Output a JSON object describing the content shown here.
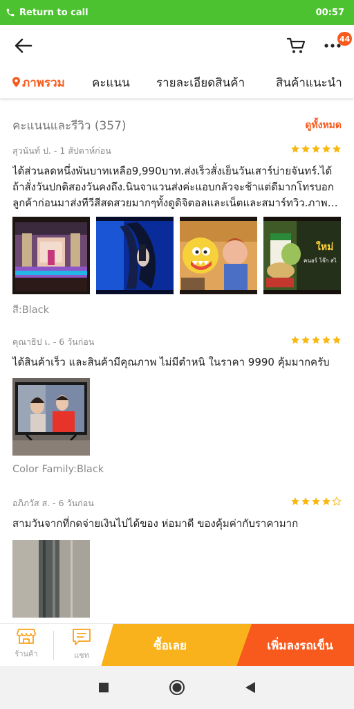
{
  "status_bar": {
    "call_text": "Return to call",
    "time": "00:57",
    "bg_color": "#4cc231"
  },
  "header": {
    "cart_badge": "44",
    "accent": "#f85a1d"
  },
  "tabs": [
    {
      "label": "ภาพรวม",
      "active": true
    },
    {
      "label": "คะแนน",
      "active": false
    },
    {
      "label": "รายละเอียดสินค้า",
      "active": false
    },
    {
      "label": "สินค้าแนะนำ",
      "active": false
    }
  ],
  "ratings_section": {
    "title": "คะแนนและรีวิว (357)",
    "see_all": "ดูทั้งหมด"
  },
  "reviews": [
    {
      "author_time": "สุวนันท์ ป. - 1 สัปดาห์ก่อน",
      "stars": 5,
      "text": "ได้ส่วนลดหนึ่งพันบาทเหลือ9,990บาท.ส่งเร็วสั่งเย็นวันเสาร์บ่ายจันทร์.ได้ถ้าสั่งวันปกติสองวันคงถึง.นินจาแวนส่งค่ะแอบกลัวจะช้าแต่ดีมากโทรบอกลูกค้าก่อนมาส่งทีวีสีสดสวยมากๆทั้งดูดิจิตอลและเน็ตและสมาร์ทวิว.ภาพสวยมากค่ะ",
      "images": [
        "tv-purple-palace-scene",
        "tv-blue-long-hair-scene",
        "tv-cartoon-shark-scene",
        "tv-food-advert-scene"
      ],
      "ad_overlay_text": "ใหม่",
      "ad_overlay_sub": "คนอร์ โจ๊ก สไ",
      "variant": "สี:Black"
    },
    {
      "author_time": "คุณาธิป เ. - 6 วันก่อน",
      "stars": 5,
      "text": "ได้สินค้าเร็ว และสินค้ามีคุณภาพ ไม่มีตำหนิ ในราคา 9990 คุ้มมากครับ",
      "images": [
        "tv-drama-scene"
      ],
      "variant": "Color Family:Black"
    },
    {
      "author_time": "อภิภวัส ส. - 6 วันก่อน",
      "stars": 4,
      "text": "สามวันจากที่กดจ่ายเงินไปได้ของ ห่อมาดี ของคุ้มค่ากับราคามาก",
      "images": [
        "tv-box-wrapped"
      ]
    }
  ],
  "bottom_bar": {
    "store_label": "ร้านค้า",
    "chat_label": "แชท",
    "buy_label": "ซื้อเลย",
    "add_cart_label": "เพิ่มลงรถเข็น",
    "buy_color": "#f9a11b",
    "add_color": "#f85a1d"
  },
  "icons": [
    "phone-icon",
    "back-arrow-icon",
    "cart-icon",
    "more-icon",
    "location-pin-icon",
    "star-icon",
    "store-icon",
    "chat-icon",
    "nav-recents-icon",
    "nav-home-icon",
    "nav-back-icon"
  ]
}
